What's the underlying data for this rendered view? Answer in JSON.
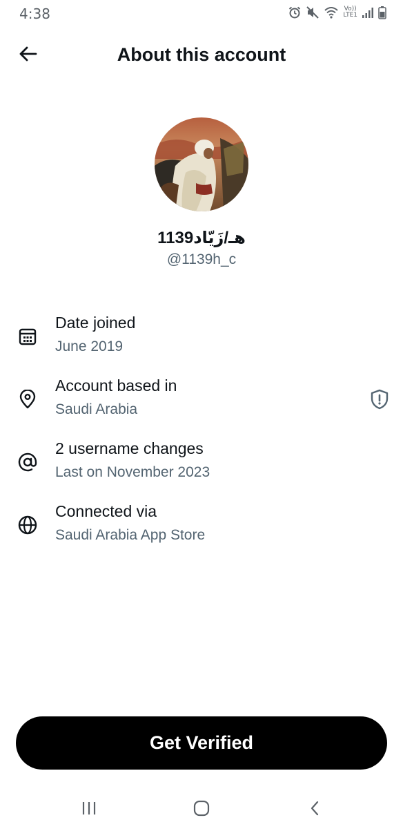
{
  "status_bar": {
    "time": "4:38",
    "icons": [
      "alarm-icon",
      "mute-icon",
      "wifi-icon",
      "lte-icon",
      "signal-icon",
      "battery-icon"
    ],
    "lte_top": "Vo))",
    "lte_bottom": "LTE1"
  },
  "header": {
    "title": "About this account",
    "back_icon": "arrow-left-icon"
  },
  "profile": {
    "display_name": "1139هـ/زَيّاد",
    "handle": "@1139h_c"
  },
  "rows": [
    {
      "icon": "calendar-icon",
      "title": "Date joined",
      "subtitle": "June 2019"
    },
    {
      "icon": "location-pin-icon",
      "title": "Account based in",
      "subtitle": "Saudi Arabia",
      "trailing_icon": "shield-alert-icon"
    },
    {
      "icon": "at-sign-icon",
      "title": "2 username changes",
      "subtitle": "Last on November 2023"
    },
    {
      "icon": "globe-icon",
      "title": "Connected via",
      "subtitle": "Saudi Arabia App Store"
    }
  ],
  "cta": {
    "label": "Get Verified"
  },
  "nav_bar": {
    "items": [
      "recent-apps-icon",
      "home-icon",
      "back-icon"
    ]
  },
  "colors": {
    "text_primary": "#0f1419",
    "text_secondary": "#536471",
    "button_bg": "#000000",
    "button_text": "#ffffff",
    "background": "#ffffff"
  }
}
